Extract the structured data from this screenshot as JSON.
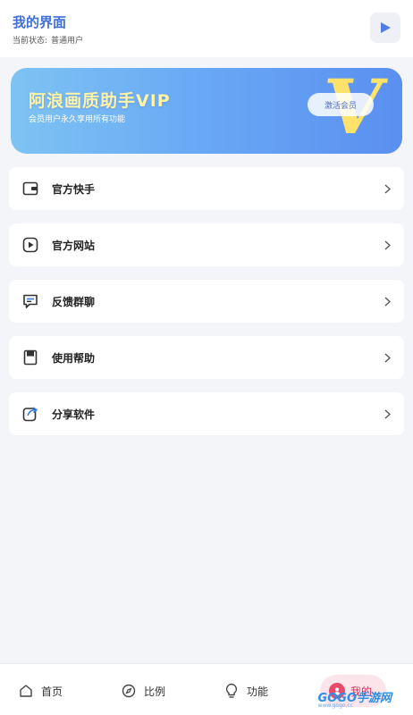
{
  "header": {
    "title": "我的界面",
    "status_label": "当前状态:",
    "status_value": "普通用户",
    "play_icon": "play-icon"
  },
  "vip": {
    "title": "阿浪画质助手VIP",
    "subtitle": "会员用户永久享用所有功能",
    "activate_label": "激活会员",
    "big_letter": "V"
  },
  "menu": {
    "items": [
      {
        "label": "官方快手",
        "icon": "wallet-icon"
      },
      {
        "label": "官方网站",
        "icon": "play-square-icon"
      },
      {
        "label": "反馈群聊",
        "icon": "chat-icon"
      },
      {
        "label": "使用帮助",
        "icon": "book-icon"
      },
      {
        "label": "分享软件",
        "icon": "share-icon"
      }
    ]
  },
  "tabbar": {
    "tabs": [
      {
        "label": "首页",
        "icon": "home-icon"
      },
      {
        "label": "比例",
        "icon": "compass-icon"
      },
      {
        "label": "功能",
        "icon": "bulb-icon"
      },
      {
        "label": "我的",
        "icon": "user-icon"
      }
    ]
  },
  "watermark": {
    "text": "GOGO手游网",
    "url": "www.gogo.cc"
  },
  "colors": {
    "accent": "#3f6fd8",
    "vip_gradient_start": "#7ec3f3",
    "vip_gradient_end": "#5b8ff0",
    "vip_gold": "#ffe26a",
    "active_tab": "#e0285a"
  }
}
